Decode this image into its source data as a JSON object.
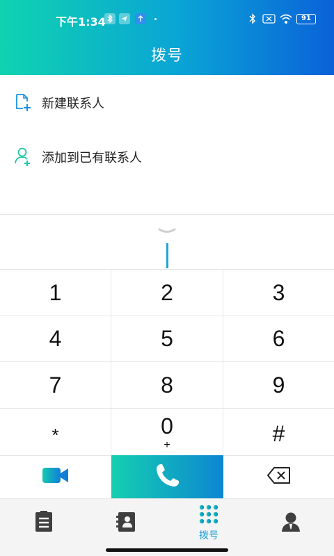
{
  "status_bar": {
    "time": "下午1:34",
    "battery": "91",
    "icons": [
      "bluetooth-icon",
      "location-icon",
      "upload-icon",
      "bluetooth-icon",
      "no-sim-icon",
      "wifi-icon",
      "battery-icon"
    ]
  },
  "header": {
    "title": "拨号"
  },
  "actions": {
    "new_contact": {
      "label": "新建联系人",
      "icon": "add-document-icon"
    },
    "add_existing": {
      "label": "添加到已有联系人",
      "icon": "add-person-icon"
    }
  },
  "keypad": {
    "keys": [
      {
        "main": "1",
        "sub": ""
      },
      {
        "main": "2",
        "sub": ""
      },
      {
        "main": "3",
        "sub": ""
      },
      {
        "main": "4",
        "sub": ""
      },
      {
        "main": "5",
        "sub": ""
      },
      {
        "main": "6",
        "sub": ""
      },
      {
        "main": "7",
        "sub": ""
      },
      {
        "main": "8",
        "sub": ""
      },
      {
        "main": "9",
        "sub": ""
      },
      {
        "main": "*",
        "sub": ""
      },
      {
        "main": "0",
        "sub": "+"
      },
      {
        "main": "#",
        "sub": ""
      }
    ]
  },
  "bottom_actions": {
    "video": "video-call-icon",
    "call": "phone-icon",
    "delete": "backspace-icon"
  },
  "tabs": [
    {
      "icon": "list-icon",
      "label": ""
    },
    {
      "icon": "contacts-book-icon",
      "label": ""
    },
    {
      "icon": "dialpad-icon",
      "label": "拨号",
      "active": true
    },
    {
      "icon": "profile-icon",
      "label": ""
    }
  ],
  "colors": {
    "header_start": "#0fd3b0",
    "header_end": "#0a62d8",
    "accent": "#1a9fd6",
    "call_gradient_start": "#14cfb0",
    "call_gradient_end": "#0d86d2"
  }
}
